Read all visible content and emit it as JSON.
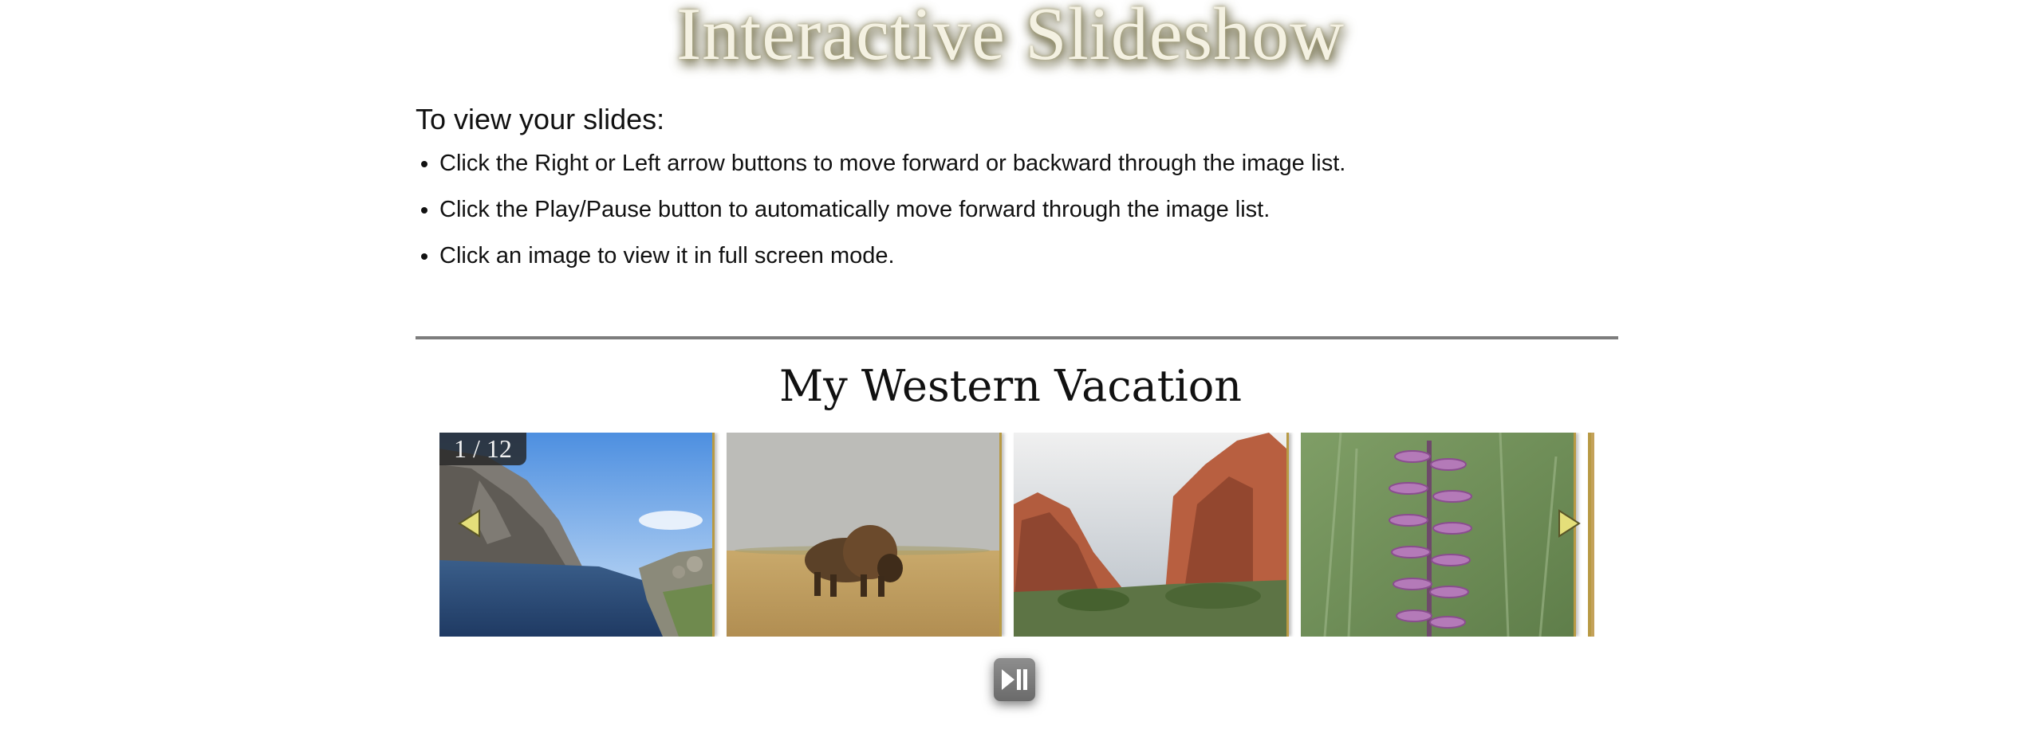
{
  "page": {
    "title": "Interactive Slideshow"
  },
  "instructions": {
    "heading": "To view your slides:",
    "items": [
      "Click the Right or Left arrow buttons to move forward or backward through the image list.",
      "Click the Play/Pause button to automatically move forward through the image list.",
      "Click an image to view it in full screen mode."
    ]
  },
  "slideshow": {
    "title": "My Western Vacation",
    "counter": "1 / 12",
    "current_slide": 1,
    "total_slides": 12,
    "visible_slides": [
      {
        "subject": "mountain lake"
      },
      {
        "subject": "bison on prairie"
      },
      {
        "subject": "red rock formations"
      },
      {
        "subject": "purple wildflower"
      }
    ],
    "controls": {
      "prev_icon": "triangle-left-icon",
      "next_icon": "triangle-right-icon",
      "play_pause_icon": "play-pause-icon"
    }
  },
  "colors": {
    "title_fill": "#f4f1e2",
    "title_shadow": "#6f6a44",
    "slide_border": "#b89a44",
    "arrow": "#e4df7a"
  }
}
